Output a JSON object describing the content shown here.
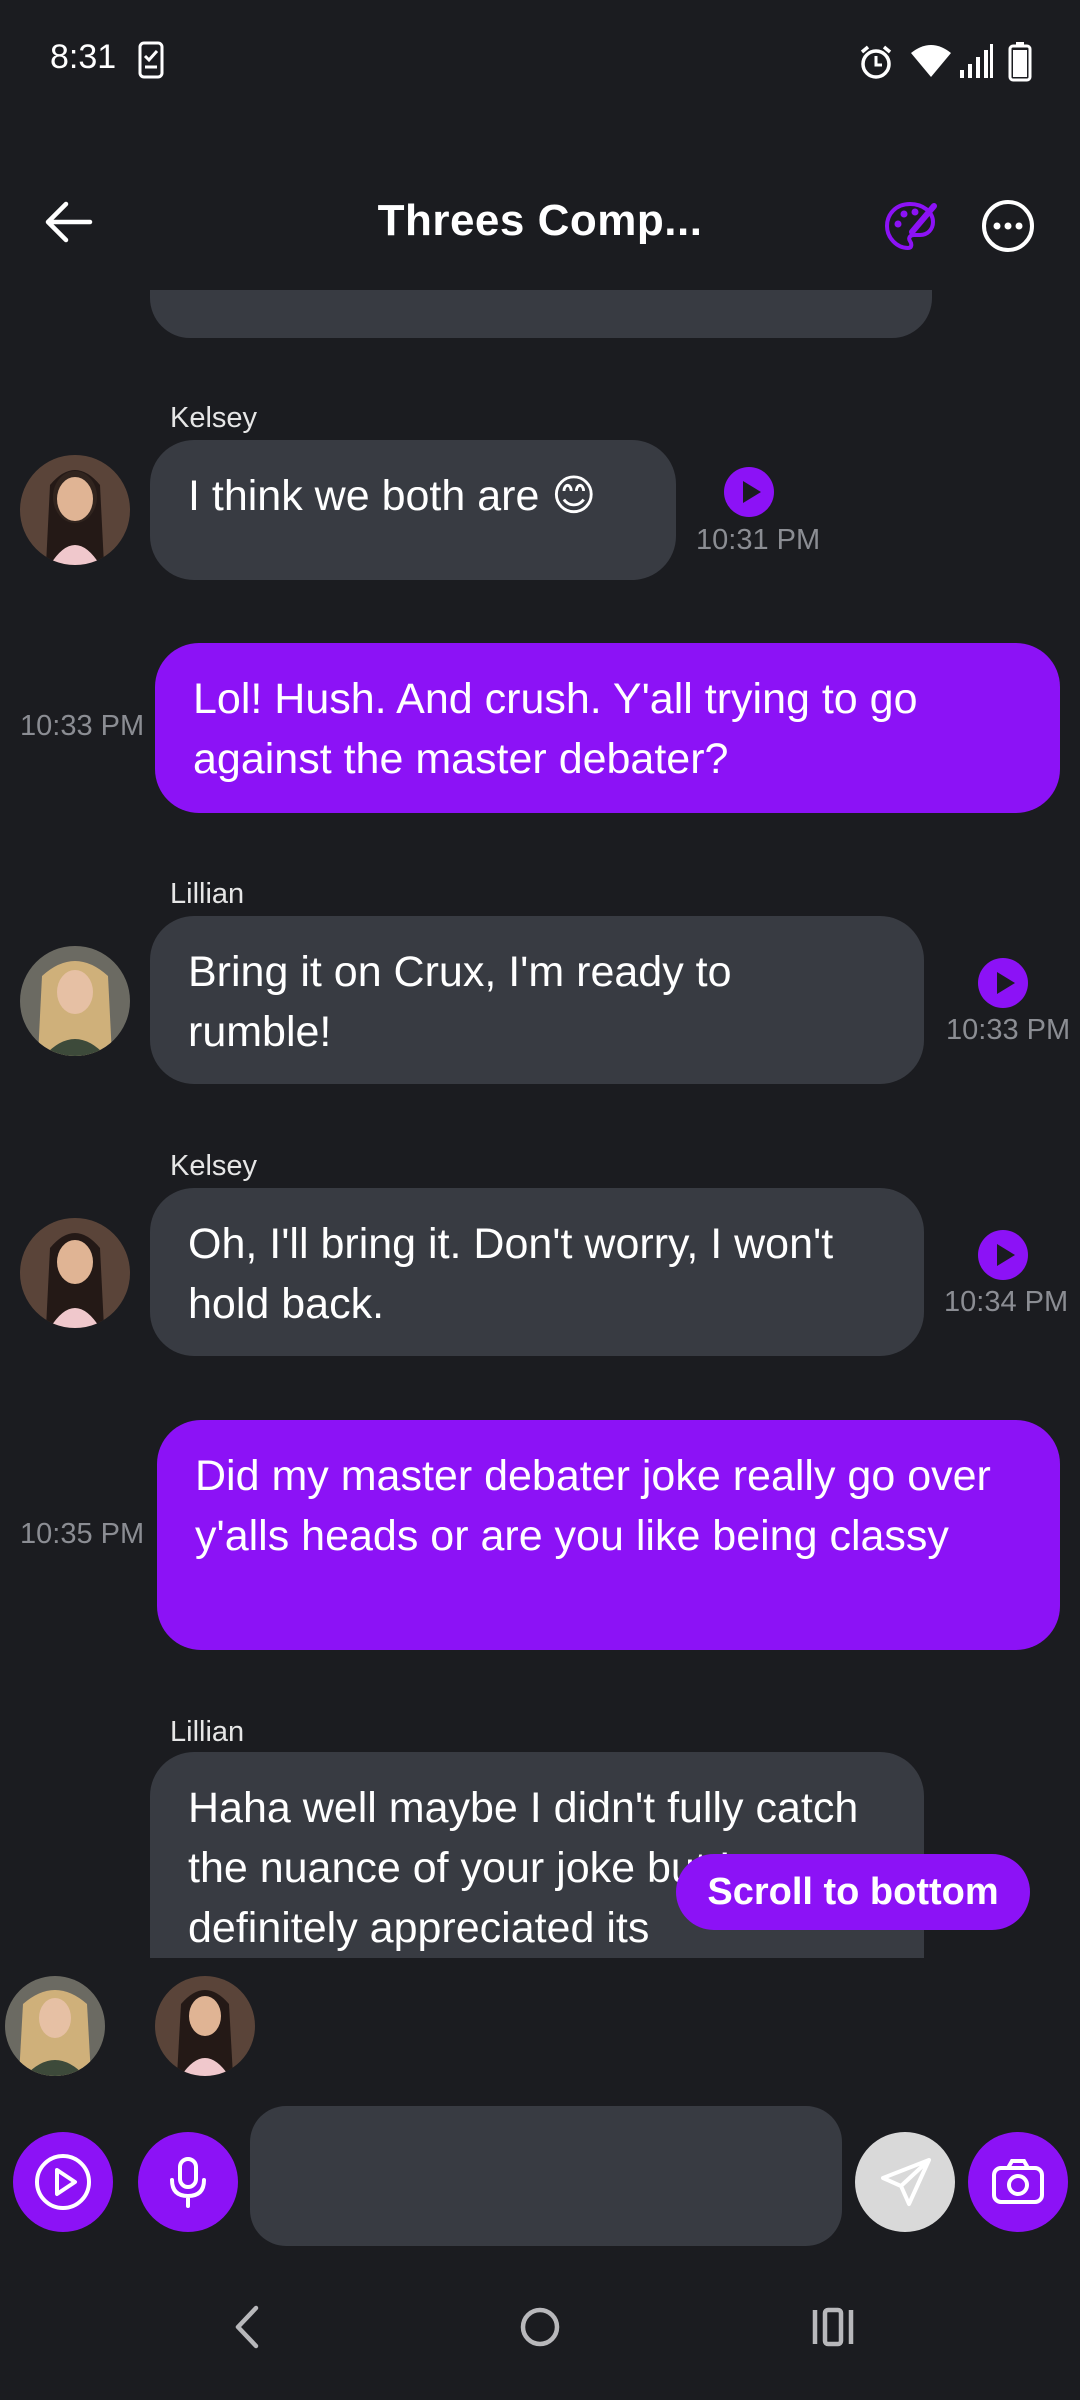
{
  "status_bar": {
    "time": "8:31"
  },
  "header": {
    "title": "Threes Comp..."
  },
  "messages": [
    {
      "type": "in",
      "sender": "Kelsey",
      "text": "I think we both are 😊",
      "time": "10:31 PM"
    },
    {
      "type": "out",
      "text": "Lol! Hush. And crush. Y'all trying to go against the master debater?",
      "time": "10:33 PM"
    },
    {
      "type": "in",
      "sender": "Lillian",
      "text": "Bring it on Crux, I'm ready to rumble!",
      "time": "10:33 PM"
    },
    {
      "type": "in",
      "sender": "Kelsey",
      "text": "Oh, I'll bring it. Don't worry, I won't hold back.",
      "time": "10:34 PM"
    },
    {
      "type": "out",
      "text": "Did my master debater joke really go over y'alls heads or are you like being classy",
      "time": "10:35 PM"
    },
    {
      "type": "in",
      "sender": "Lillian",
      "text": "Haha well maybe I didn't fully catch the nuance of your joke but I definitely appreciated its"
    }
  ],
  "scroll_to_bottom": "Scroll to bottom",
  "composer": {
    "placeholder": ""
  },
  "colors": {
    "accent": "#8c12f6",
    "bubble_in": "#383b42",
    "background": "#1b1c20"
  }
}
